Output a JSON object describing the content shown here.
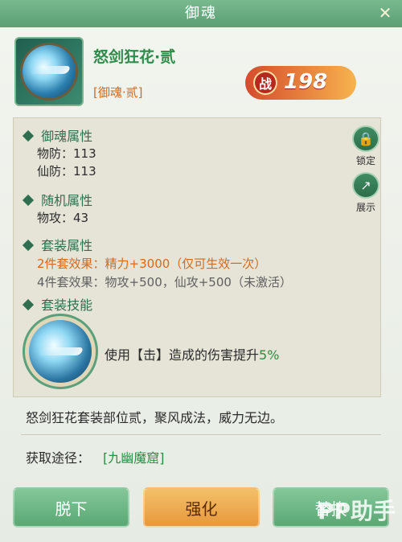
{
  "window": {
    "title": "御魂"
  },
  "item": {
    "name": "怒剑狂花·贰",
    "tag": "[御魂·贰]",
    "power": {
      "label": "战",
      "value": "198"
    }
  },
  "sections": {
    "base": {
      "title": "御魂属性",
      "lines": [
        "物防：113",
        "仙防：113"
      ]
    },
    "random": {
      "title": "随机属性",
      "lines": [
        "物攻：43"
      ]
    },
    "set": {
      "title": "套装属性",
      "lines": [
        {
          "text": "2件套效果：精力+3000（仅可生效一次）"
        },
        {
          "text": "4件套效果：物攻+500，仙攻+500（未激活）"
        }
      ]
    },
    "skill": {
      "title": "套装技能",
      "pre": "使用【击】造成的伤害提升",
      "highlight": "5%"
    }
  },
  "side": {
    "lock": "锁定",
    "show": "展示"
  },
  "description": "怒剑狂花套装部位贰，聚风成法，威力无边。",
  "source": {
    "label": "获取途径：",
    "value": "[九幽魔窟]"
  },
  "buttons": {
    "unequip": "脱下",
    "enhance": "强化",
    "replace": "替换"
  },
  "watermark": "PP助手"
}
